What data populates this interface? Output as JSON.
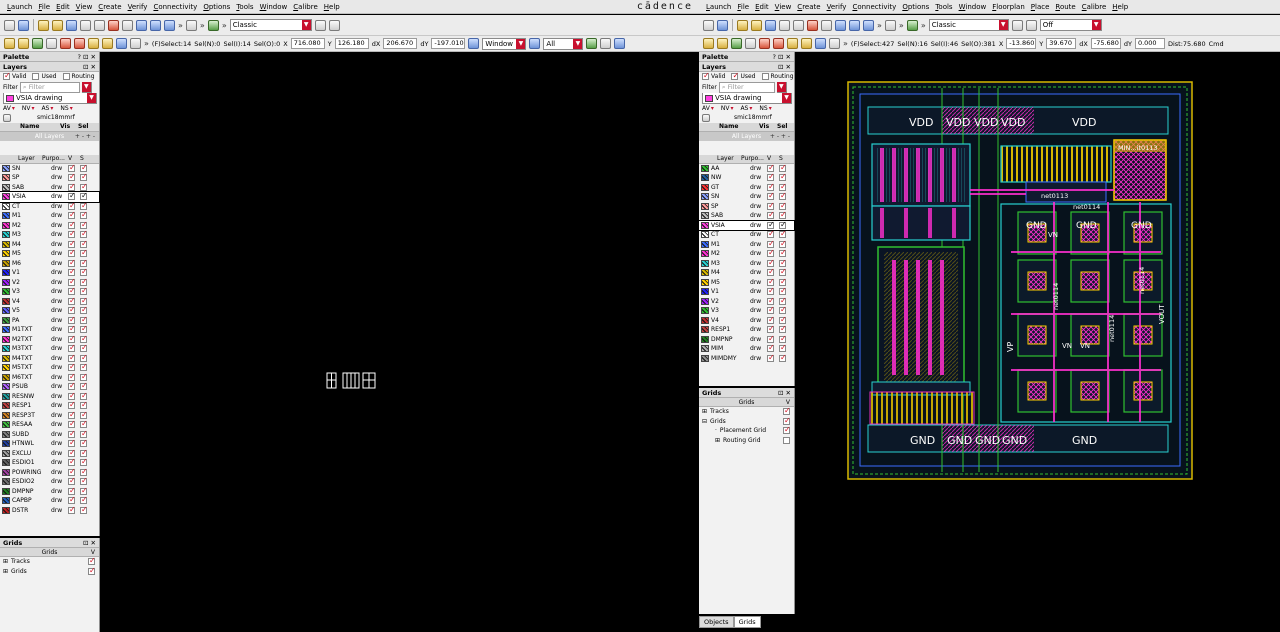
{
  "left": {
    "menu": [
      "Launch",
      "File",
      "Edit",
      "View",
      "Create",
      "Verify",
      "Connectivity",
      "Options",
      "Tools",
      "Window",
      "Calibre",
      "Help"
    ],
    "brand": "cādence",
    "toolbar": {
      "style_combo": "Classic"
    },
    "status": {
      "select": "(F)Select:14",
      "seln": "Sel(N):0",
      "seli": "Sel(I):14",
      "selo": "Sel(O):0",
      "x_label": "X",
      "x": "716.080",
      "y_label": "Y",
      "y": "126.180",
      "dx_label": "dX",
      "dx": "206.670",
      "dy_label": "dY",
      "dy": "-197.010",
      "window_combo": "Window",
      "all_combo": "All"
    },
    "palette": {
      "title": "Palette",
      "layers_title": "Layers",
      "filters": [
        {
          "label": "Valid",
          "checked": true
        },
        {
          "label": "Used",
          "checked": false
        },
        {
          "label": "Routing",
          "checked": false
        }
      ],
      "filter_label": "Filter",
      "filter_placeholder": "Filter",
      "lpp_combo": "VSIA drawing",
      "av_buttons": [
        "AV",
        "NV",
        "AS",
        "NS"
      ],
      "techlib": "smic18mmrf",
      "set_cols": [
        "Name",
        "Vis",
        "Sel"
      ],
      "all_layers": "All Layers",
      "layer_cols": [
        "Layer",
        "Purpo...",
        "V",
        "S"
      ],
      "layers": [
        {
          "name": "SN",
          "purpose": "drw",
          "color": "#8aa2ff"
        },
        {
          "name": "SP",
          "purpose": "drw",
          "color": "#ff9a9a"
        },
        {
          "name": "SAB",
          "purpose": "drw",
          "color": "#c0c0c0"
        },
        {
          "name": "VSIA",
          "purpose": "drw",
          "color": "#ff3fe0",
          "selected": true
        },
        {
          "name": "CT",
          "purpose": "drw",
          "color": "#ffffff"
        },
        {
          "name": "M1",
          "purpose": "drw",
          "color": "#3b6cff"
        },
        {
          "name": "M2",
          "purpose": "drw",
          "color": "#ff2fd0"
        },
        {
          "name": "M3",
          "purpose": "drw",
          "color": "#28d0d0"
        },
        {
          "name": "M4",
          "purpose": "drw",
          "color": "#d8b800"
        },
        {
          "name": "M5",
          "purpose": "drw",
          "color": "#ffd000"
        },
        {
          "name": "M6",
          "purpose": "drw",
          "color": "#c8a000"
        },
        {
          "name": "V1",
          "purpose": "drw",
          "color": "#2020ff"
        },
        {
          "name": "V2",
          "purpose": "drw",
          "color": "#a020ff"
        },
        {
          "name": "V3",
          "purpose": "drw",
          "color": "#30c030"
        },
        {
          "name": "V4",
          "purpose": "drw",
          "color": "#c03030"
        },
        {
          "name": "V5",
          "purpose": "drw",
          "color": "#6060ff"
        },
        {
          "name": "PA",
          "purpose": "drw",
          "color": "#40a040"
        },
        {
          "name": "M1TXT",
          "purpose": "drw",
          "color": "#3b6cff"
        },
        {
          "name": "M2TXT",
          "purpose": "drw",
          "color": "#ff2fd0"
        },
        {
          "name": "M3TXT",
          "purpose": "drw",
          "color": "#28d0d0"
        },
        {
          "name": "M4TXT",
          "purpose": "drw",
          "color": "#d8b800"
        },
        {
          "name": "M5TXT",
          "purpose": "drw",
          "color": "#ffd000"
        },
        {
          "name": "M6TXT",
          "purpose": "drw",
          "color": "#c8a000"
        },
        {
          "name": "PSUB",
          "purpose": "drw",
          "color": "#b060ff"
        },
        {
          "name": "RESNW",
          "purpose": "drw",
          "color": "#20a0a0"
        },
        {
          "name": "RESP1",
          "purpose": "drw",
          "color": "#c04040"
        },
        {
          "name": "RESP3T",
          "purpose": "drw",
          "color": "#d08020"
        },
        {
          "name": "RESAA",
          "purpose": "drw",
          "color": "#40c040"
        },
        {
          "name": "SUBD",
          "purpose": "drw",
          "color": "#808080"
        },
        {
          "name": "HTNWL",
          "purpose": "drw",
          "color": "#2040a0"
        },
        {
          "name": "EXCLU",
          "purpose": "drw",
          "color": "#a0a0a0"
        },
        {
          "name": "ESDIO1",
          "purpose": "drw",
          "color": "#606060"
        },
        {
          "name": "POWRING",
          "purpose": "drw",
          "color": "#a040a0"
        },
        {
          "name": "ESDIO2",
          "purpose": "drw",
          "color": "#707070"
        },
        {
          "name": "DMPNP",
          "purpose": "drw",
          "color": "#208020"
        },
        {
          "name": "CAPBP",
          "purpose": "drw",
          "color": "#2060c0"
        },
        {
          "name": "DSTR",
          "purpose": "drw",
          "color": "#c02020"
        }
      ]
    },
    "grids": {
      "title": "Grids",
      "col": "Grids",
      "col_v": "V",
      "items": [
        {
          "label": "Tracks"
        },
        {
          "label": "Grids"
        }
      ]
    }
  },
  "right": {
    "menu": [
      "Launch",
      "File",
      "Edit",
      "View",
      "Create",
      "Verify",
      "Connectivity",
      "Options",
      "Tools",
      "Window",
      "Floorplan",
      "Place",
      "Route",
      "Calibre",
      "Help"
    ],
    "toolbar": {
      "style_combo": "Classic",
      "off_combo": "Off"
    },
    "status": {
      "select": "(F)Select:427",
      "seln": "Sel(N):16",
      "seli": "Sel(I):46",
      "selo": "Sel(O):381",
      "x_label": "X",
      "x": "-13.860",
      "y_label": "Y",
      "y": "39.670",
      "dx_label": "dX",
      "dx": "-75.680",
      "dy_label": "dY",
      "dy": "0.000",
      "dist": "Dist:75.680",
      "cmd": "Cmd"
    },
    "palette": {
      "title": "Palette",
      "layers_title": "Layers",
      "filters": [
        {
          "label": "Valid",
          "checked": true
        },
        {
          "label": "Used",
          "checked": true
        },
        {
          "label": "Routing",
          "checked": false
        }
      ],
      "filter_label": "Filter",
      "filter_placeholder": "Filter",
      "lpp_combo": "VSIA drawing",
      "av_buttons": [
        "AV",
        "NV",
        "AS",
        "NS"
      ],
      "techlib": "smic18mmrf",
      "set_cols": [
        "Name",
        "Vis",
        "Sel"
      ],
      "all_layers": "All Layers",
      "layer_cols": [
        "Layer",
        "Purpo...",
        "V",
        "S"
      ],
      "layers": [
        {
          "name": "AA",
          "purpose": "drw",
          "color": "#30c030"
        },
        {
          "name": "NW",
          "purpose": "drw",
          "color": "#2060a0"
        },
        {
          "name": "GT",
          "purpose": "drw",
          "color": "#ff3030"
        },
        {
          "name": "SN",
          "purpose": "drw",
          "color": "#8aa2ff"
        },
        {
          "name": "SP",
          "purpose": "drw",
          "color": "#ff9a9a"
        },
        {
          "name": "SAB",
          "purpose": "drw",
          "color": "#c0c0c0"
        },
        {
          "name": "VSIA",
          "purpose": "drw",
          "color": "#ff3fe0",
          "selected": true
        },
        {
          "name": "CT",
          "purpose": "drw",
          "color": "#ffffff"
        },
        {
          "name": "M1",
          "purpose": "drw",
          "color": "#3b6cff"
        },
        {
          "name": "M2",
          "purpose": "drw",
          "color": "#ff2fd0"
        },
        {
          "name": "M3",
          "purpose": "drw",
          "color": "#28d0d0"
        },
        {
          "name": "M4",
          "purpose": "drw",
          "color": "#d8b800"
        },
        {
          "name": "M5",
          "purpose": "drw",
          "color": "#ffd000"
        },
        {
          "name": "V1",
          "purpose": "drw",
          "color": "#2020ff"
        },
        {
          "name": "V2",
          "purpose": "drw",
          "color": "#a020ff"
        },
        {
          "name": "V3",
          "purpose": "drw",
          "color": "#30c030"
        },
        {
          "name": "V4",
          "purpose": "drw",
          "color": "#c03030"
        },
        {
          "name": "RESP1",
          "purpose": "drw",
          "color": "#c04040"
        },
        {
          "name": "DMPNP",
          "purpose": "drw",
          "color": "#208020"
        },
        {
          "name": "MIM",
          "purpose": "drw",
          "color": "#b0b0b0"
        },
        {
          "name": "MIMDMY",
          "purpose": "drw",
          "color": "#909090"
        }
      ]
    },
    "grids": {
      "title": "Grids",
      "col": "Grids",
      "col_v": "V",
      "items": [
        {
          "label": "Tracks"
        },
        {
          "label": "Grids"
        },
        {
          "label": "Placement Grid"
        },
        {
          "label": "Routing Grid"
        }
      ]
    },
    "tabs": [
      "Objects",
      "Grids"
    ],
    "layout_labels": {
      "vdd": [
        "VDD",
        "VDD",
        "VDD",
        "VDD",
        "VDD"
      ],
      "gnd_bottom": [
        "GND",
        "GND",
        "GND",
        "GND",
        "GND"
      ],
      "gnd_top": [
        "GND",
        "GND",
        "GND"
      ],
      "vn": [
        "VN",
        "VN",
        "VN"
      ],
      "vp": "VP",
      "nets": [
        "net0113",
        "net0114",
        "net0114",
        "net0114",
        "net0114"
      ],
      "mim_label": "MIN...it0113",
      "vout": "VOUT"
    }
  }
}
